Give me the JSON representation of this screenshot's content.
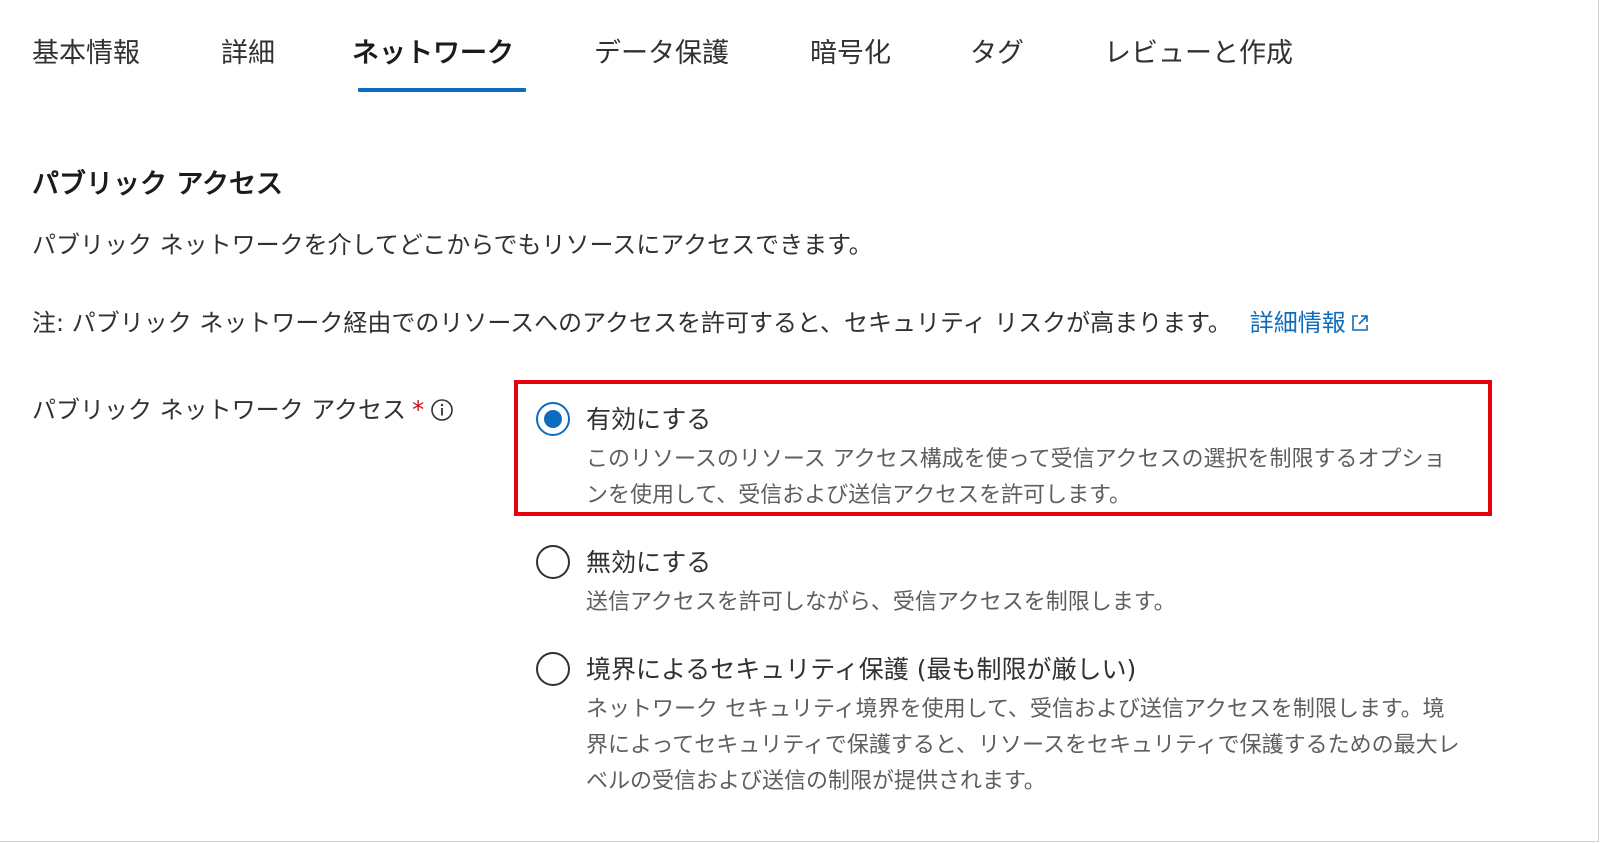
{
  "tabs": {
    "items": [
      {
        "label": "基本情報"
      },
      {
        "label": "詳細"
      },
      {
        "label": "ネットワーク"
      },
      {
        "label": "データ保護"
      },
      {
        "label": "暗号化"
      },
      {
        "label": "タグ"
      },
      {
        "label": "レビューと作成"
      }
    ],
    "active": "ネットワーク",
    "accent_color": "#0f6cbd"
  },
  "section": {
    "title": "パブリック アクセス",
    "description": "パブリック ネットワークを介してどこからでもリソースにアクセスできます。",
    "note": "注: パブリック ネットワーク経由でのリソースへのアクセスを許可すると、セキュリティ リスクが高まります。",
    "learn_more_link": "詳細情報",
    "learn_more_icon": "external-link-icon"
  },
  "field": {
    "label": "パブリック ネットワーク アクセス",
    "required_marker": "*",
    "info_icon": "info-icon"
  },
  "options": [
    {
      "label": "有効にする",
      "description": "このリソースのリソース アクセス構成を使って受信アクセスの選択を制限するオプションを使用して、受信および送信アクセスを許可します。",
      "selected": true
    },
    {
      "label": "無効にする",
      "description": "送信アクセスを許可しながら、受信アクセスを制限します。",
      "selected": false
    },
    {
      "label": "境界によるセキュリティ保護 (最も制限が厳しい)",
      "description": "ネットワーク セキュリティ境界を使用して、受信および送信アクセスを制限します。境界によってセキュリティで保護すると、リソースをセキュリティで保護するための最大レベルの受信および送信の制限が提供されます。",
      "selected": false
    }
  ],
  "highlight_color": "#e8000b"
}
